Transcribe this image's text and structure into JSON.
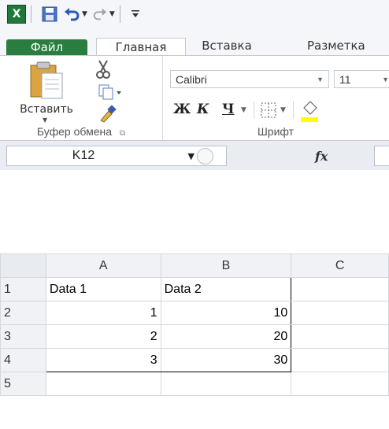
{
  "qat": {
    "app_icon": "excel-logo",
    "save_icon": "save-icon",
    "undo_icon": "undo-icon",
    "redo_icon": "redo-icon",
    "customize_icon": "customize-icon"
  },
  "tabs": {
    "file": "Файл",
    "home": "Главная",
    "insert": "Вставка",
    "layout": "Разметка"
  },
  "clipboard": {
    "paste": "Вставить",
    "group_label": "Буфер обмена"
  },
  "font": {
    "name": "Calibri",
    "size": "11",
    "bold": "Ж",
    "italic": "К",
    "underline": "Ч",
    "group_label": "Шрифт"
  },
  "formula_bar": {
    "name_box": "K12",
    "fx": "fx"
  },
  "sheet": {
    "columns": [
      "A",
      "B",
      "C"
    ],
    "rows": [
      {
        "n": "1",
        "a": "Data 1",
        "b": "Data 2"
      },
      {
        "n": "2",
        "a": "1",
        "b": "10"
      },
      {
        "n": "3",
        "a": "2",
        "b": "20"
      },
      {
        "n": "4",
        "a": "3",
        "b": "30"
      },
      {
        "n": "5",
        "a": "",
        "b": ""
      }
    ]
  },
  "colors": {
    "file_tab": "#2a7d3e",
    "excel_green": "#1f7a3a"
  }
}
